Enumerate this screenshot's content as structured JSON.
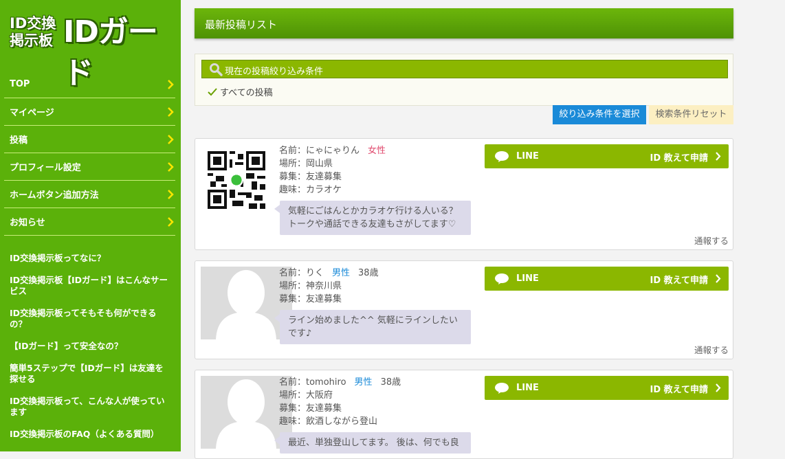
{
  "site": {
    "logo_small_line1": "ID交換",
    "logo_small_line2": "掲示板",
    "logo_big": "IDガード"
  },
  "nav": {
    "items": [
      {
        "label": "TOP"
      },
      {
        "label": "マイページ"
      },
      {
        "label": "投稿"
      },
      {
        "label": "プロフィール設定"
      },
      {
        "label": "ホームボタン追加方法"
      },
      {
        "label": "お知らせ"
      }
    ]
  },
  "sidebar_links": [
    {
      "label": "ID交換掲示板ってなに？"
    },
    {
      "label": "ID交換掲示板【IDガード】はこんなサービス"
    },
    {
      "label": "ID交換掲示板ってそもそも何ができるの？"
    },
    {
      "label": "【IDガード】って安全なの？"
    },
    {
      "label": "簡単5ステップで【IDガード】は友達を探せる"
    },
    {
      "label": "ID交換掲示板って、こんな人が使っています"
    },
    {
      "label": "ID交換掲示板のFAQ（よくある質問）"
    }
  ],
  "main": {
    "title": "最新投稿リスト",
    "filter": {
      "heading": "現在の投稿絞り込み条件",
      "current": "すべての投稿",
      "select_button": "絞り込み条件を選択",
      "reset_button": "検索条件リセット"
    }
  },
  "posts": [
    {
      "name_label": "名前：にゃにゃりん",
      "gender": "女性",
      "age": "",
      "place": "場所：岡山県",
      "purpose": "募集：友達募集",
      "hobby": "趣味：カラオケ",
      "message": "気軽にごはんとかカラオケ行ける人いる？トークや通話できる友達もさがしてます♡",
      "line_label": "LINE",
      "request_label": "ID 教えて申請",
      "report_label": "通報する"
    },
    {
      "name_label": "名前：りく",
      "gender": "男性",
      "age": "38歳",
      "place": "場所：神奈川県",
      "purpose": "募集：友達募集",
      "hobby": "",
      "message": "ライン始めました^^ 気軽にラインしたいです♪",
      "line_label": "LINE",
      "request_label": "ID 教えて申請",
      "report_label": "通報する"
    },
    {
      "name_label": "名前：tomohiro",
      "gender": "男性",
      "age": "38歳",
      "place": "場所：大阪府",
      "purpose": "募集：友達募集",
      "hobby": "趣味：飲酒しながら登山",
      "message": "最近、単独登山してます。 後は、何でも良",
      "line_label": "LINE",
      "request_label": "ID 教えて申請",
      "report_label": ""
    }
  ],
  "colors": {
    "sidebar_bg": "#5bb10a",
    "accent_green": "#8bb700",
    "select_blue": "#1a8ad8",
    "female_pink": "#e04a6e",
    "male_blue": "#1a8ad8"
  }
}
